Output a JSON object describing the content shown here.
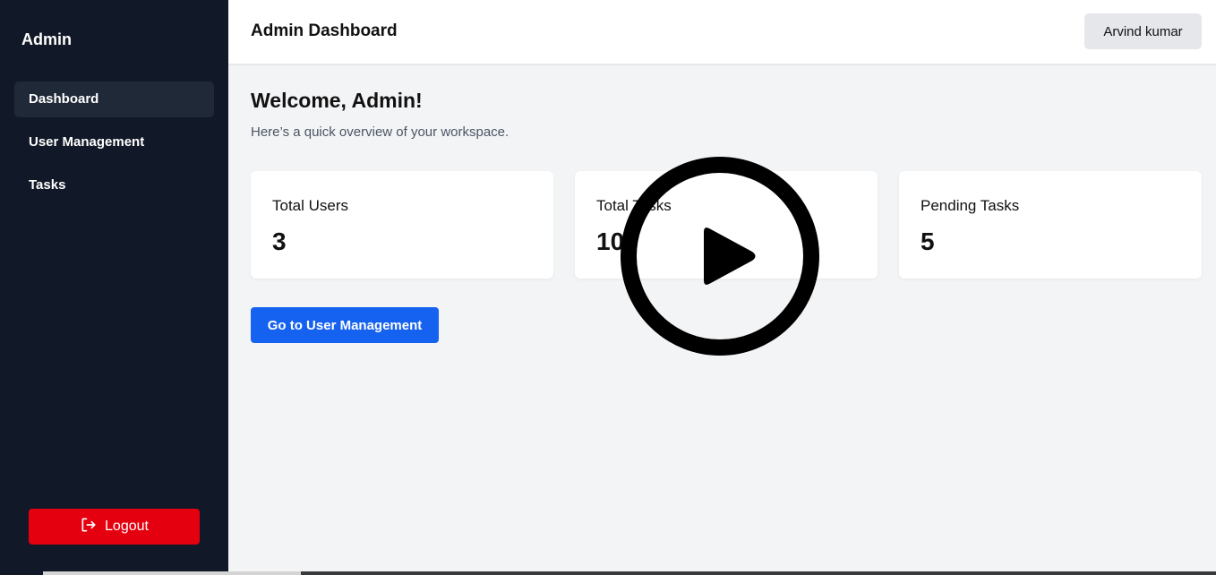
{
  "sidebar": {
    "brand": "Admin",
    "items": [
      {
        "label": "Dashboard",
        "active": true
      },
      {
        "label": "User Management",
        "active": false
      },
      {
        "label": "Tasks",
        "active": false
      }
    ],
    "logout_label": "Logout",
    "logout_icon": "logout-icon"
  },
  "header": {
    "title": "Admin Dashboard",
    "user_name": "Arvind kumar"
  },
  "main": {
    "welcome": "Welcome, Admin!",
    "subtitle": "Here’s a quick overview of your workspace.",
    "cards": [
      {
        "label": "Total Users",
        "value": "3"
      },
      {
        "label": "Total Tasks",
        "value": "10"
      },
      {
        "label": "Pending Tasks",
        "value": "5"
      }
    ],
    "cta_label": "Go to User Management"
  },
  "overlay": {
    "icon": "play-icon"
  },
  "colors": {
    "sidebar_bg": "#111827",
    "active_item_bg": "#1f2937",
    "logout_red": "#e5000f",
    "primary_blue": "#1662f0",
    "page_bg": "#f3f4f6"
  }
}
